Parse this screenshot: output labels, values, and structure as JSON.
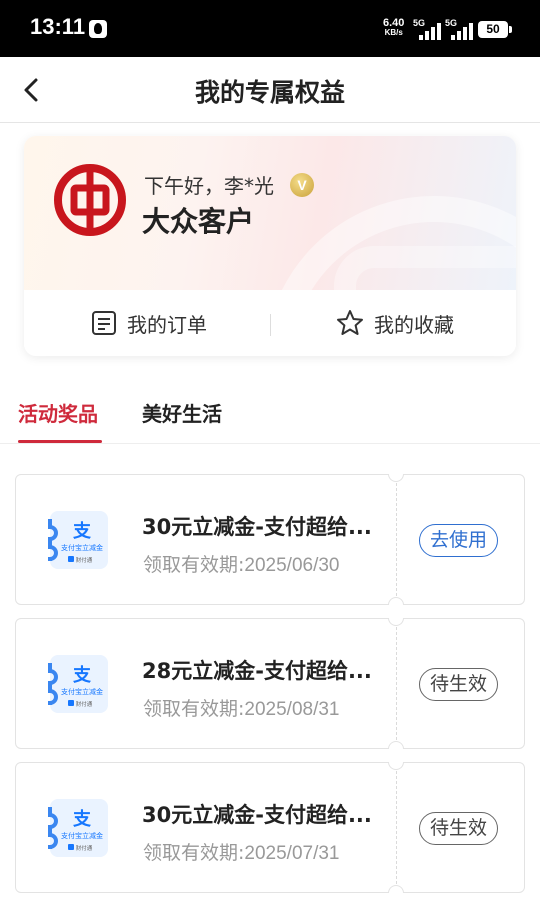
{
  "status_bar": {
    "time": "13:11",
    "net_speed": "6.40",
    "net_unit": "KB/s",
    "sim1": "5G",
    "sim2": "5G",
    "battery": "50"
  },
  "header": {
    "title": "我的专属权益"
  },
  "profile": {
    "greeting": "下午好，李*光",
    "vip_badge": "V",
    "level": "大众客户",
    "links": {
      "orders": "我的订单",
      "favorites": "我的收藏"
    }
  },
  "tabs": [
    {
      "label": "活动奖品",
      "active": true
    },
    {
      "label": "美好生活",
      "active": false
    }
  ],
  "coupons": [
    {
      "name": "30元立减金-支付超给...",
      "validity_label": "领取有效期:",
      "validity_date": "2025/06/30",
      "action": "去使用",
      "state": "use"
    },
    {
      "name": "28元立减金-支付超给...",
      "validity_label": "领取有效期:",
      "validity_date": "2025/08/31",
      "action": "待生效",
      "state": "pending"
    },
    {
      "name": "30元立减金-支付超给...",
      "validity_label": "领取有效期:",
      "validity_date": "2025/07/31",
      "action": "待生效",
      "state": "pending"
    }
  ],
  "coupon_thumb": {
    "glyph": "支",
    "caption": "支付宝立减金",
    "footer": "财付通"
  },
  "colors": {
    "brand_red": "#cf2a3c",
    "use_blue": "#2f6fd0"
  }
}
